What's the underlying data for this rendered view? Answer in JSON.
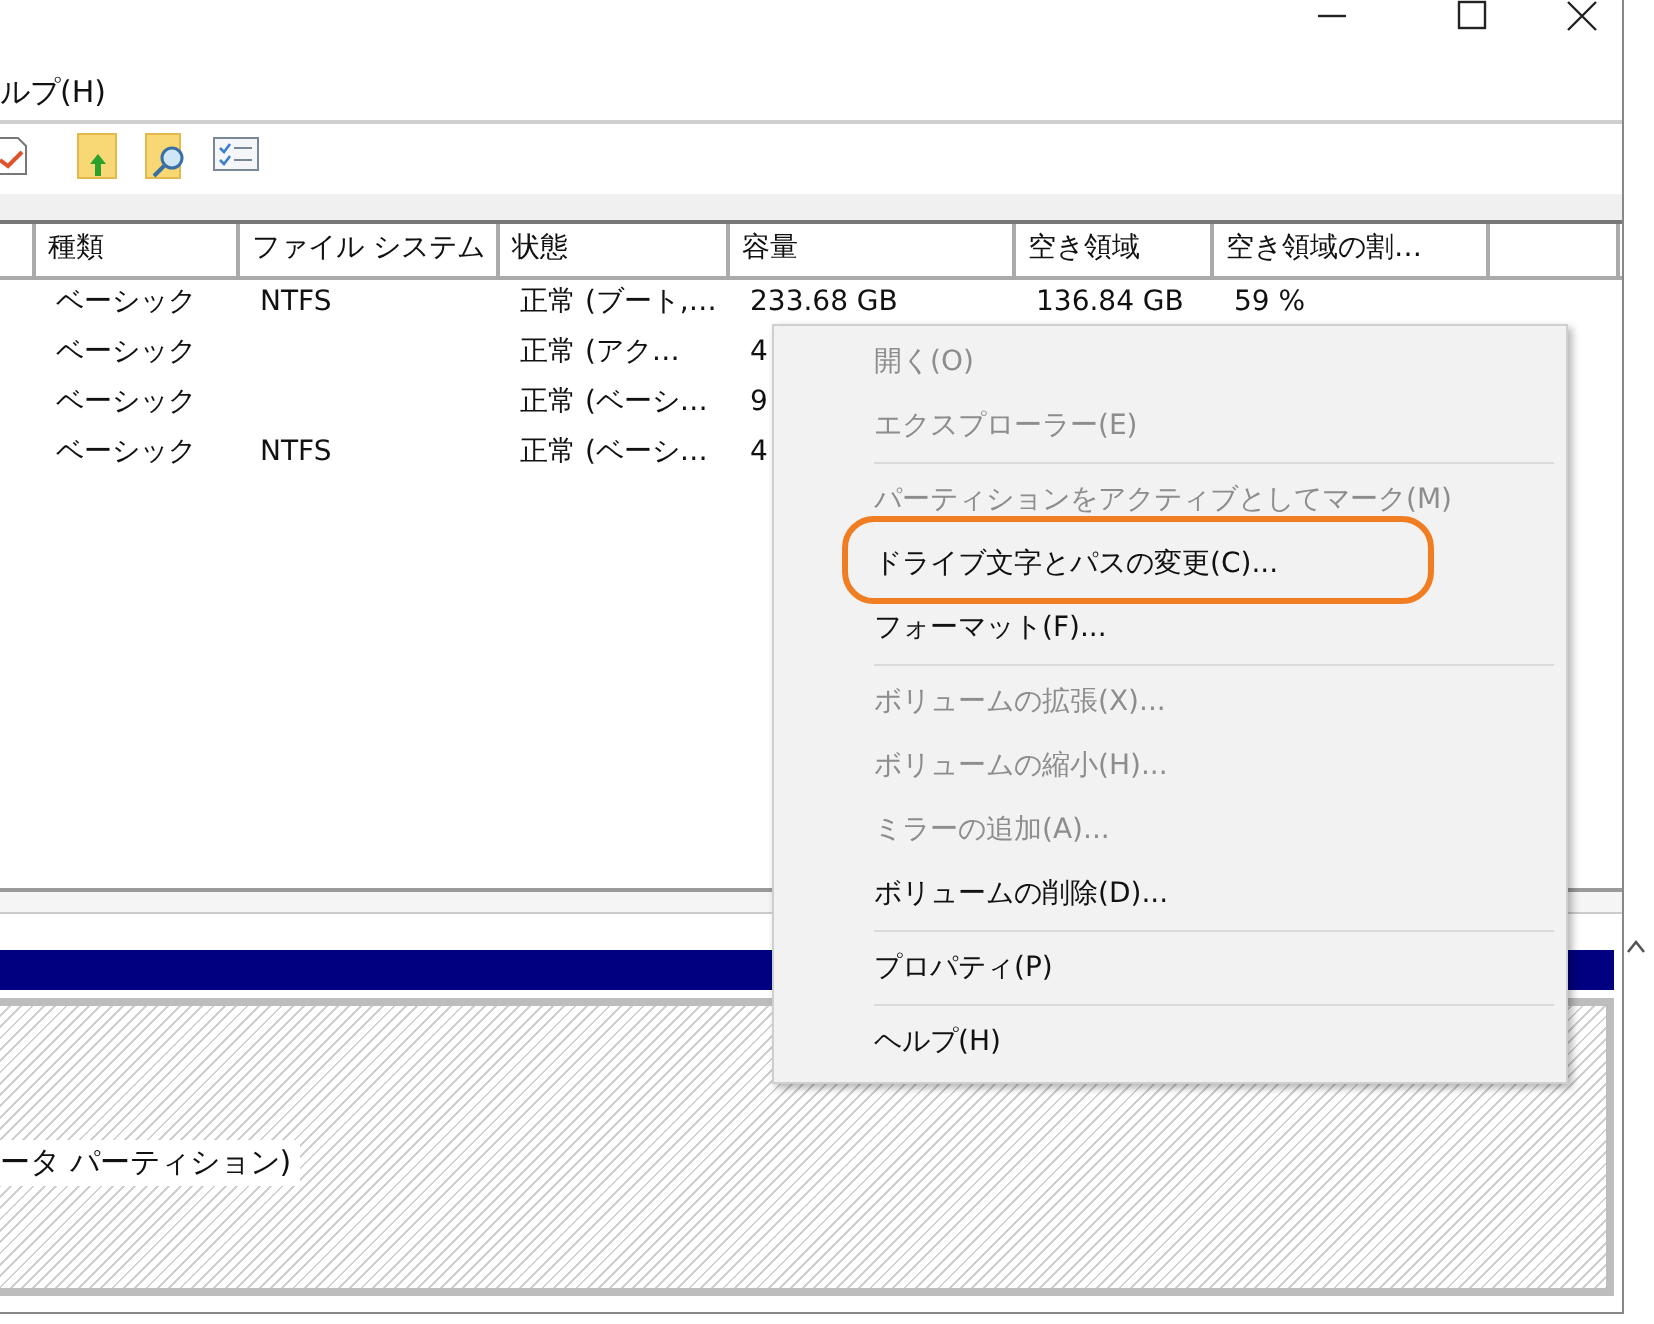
{
  "window": {
    "controls": [
      {
        "kind": "minimize"
      },
      {
        "kind": "maximize"
      },
      {
        "kind": "close"
      }
    ]
  },
  "menu_bar": {
    "items": [
      "ルプ(H)"
    ]
  },
  "toolbar": {
    "icons": [
      {
        "kind": "check-doc"
      },
      {
        "kind": "folder-up"
      },
      {
        "kind": "folder-search"
      },
      {
        "kind": "list"
      }
    ]
  },
  "table": {
    "columns": [
      "",
      "種類",
      "ファイル システム",
      "状態",
      "容量",
      "空き領域",
      "空き領域の割…",
      ""
    ],
    "rows": [
      [
        "",
        "ベーシック",
        "NTFS",
        "正常 (ブート,…",
        "233.68 GB",
        "136.84 GB",
        "59 %",
        ""
      ],
      [
        "",
        "ベーシック",
        "",
        "正常 (アク…",
        "4",
        "",
        "",
        ""
      ],
      [
        "",
        "ベーシック",
        "",
        "正常 (ベーシ…",
        "9",
        "",
        "",
        ""
      ],
      [
        "",
        "ベーシック",
        "NTFS",
        "正常 (ベーシ…",
        "4",
        "",
        "",
        ""
      ]
    ]
  },
  "disk_pane": {
    "partition_label": "ータ パーティション)"
  },
  "context_menu": {
    "items": [
      {
        "kind": "item",
        "label": "開く(O)",
        "disabled": true,
        "circled": false
      },
      {
        "kind": "item",
        "label": "エクスプローラー(E)",
        "disabled": true,
        "circled": false
      },
      {
        "kind": "separator"
      },
      {
        "kind": "item",
        "label": "パーティションをアクティブとしてマーク(M)",
        "disabled": true,
        "circled": false
      },
      {
        "kind": "item",
        "label": "ドライブ文字とパスの変更(C)...",
        "disabled": false,
        "circled": true
      },
      {
        "kind": "item",
        "label": "フォーマット(F)...",
        "disabled": false,
        "circled": false
      },
      {
        "kind": "separator"
      },
      {
        "kind": "item",
        "label": "ボリュームの拡張(X)...",
        "disabled": true,
        "circled": false
      },
      {
        "kind": "item",
        "label": "ボリュームの縮小(H)...",
        "disabled": true,
        "circled": false
      },
      {
        "kind": "item",
        "label": "ミラーの追加(A)...",
        "disabled": true,
        "circled": false
      },
      {
        "kind": "item",
        "label": "ボリュームの削除(D)...",
        "disabled": false,
        "circled": false
      },
      {
        "kind": "separator"
      },
      {
        "kind": "item",
        "label": "プロパティ(P)",
        "disabled": false,
        "circled": false
      },
      {
        "kind": "separator"
      },
      {
        "kind": "item",
        "label": "ヘルプ(H)",
        "disabled": false,
        "circled": false
      }
    ]
  }
}
